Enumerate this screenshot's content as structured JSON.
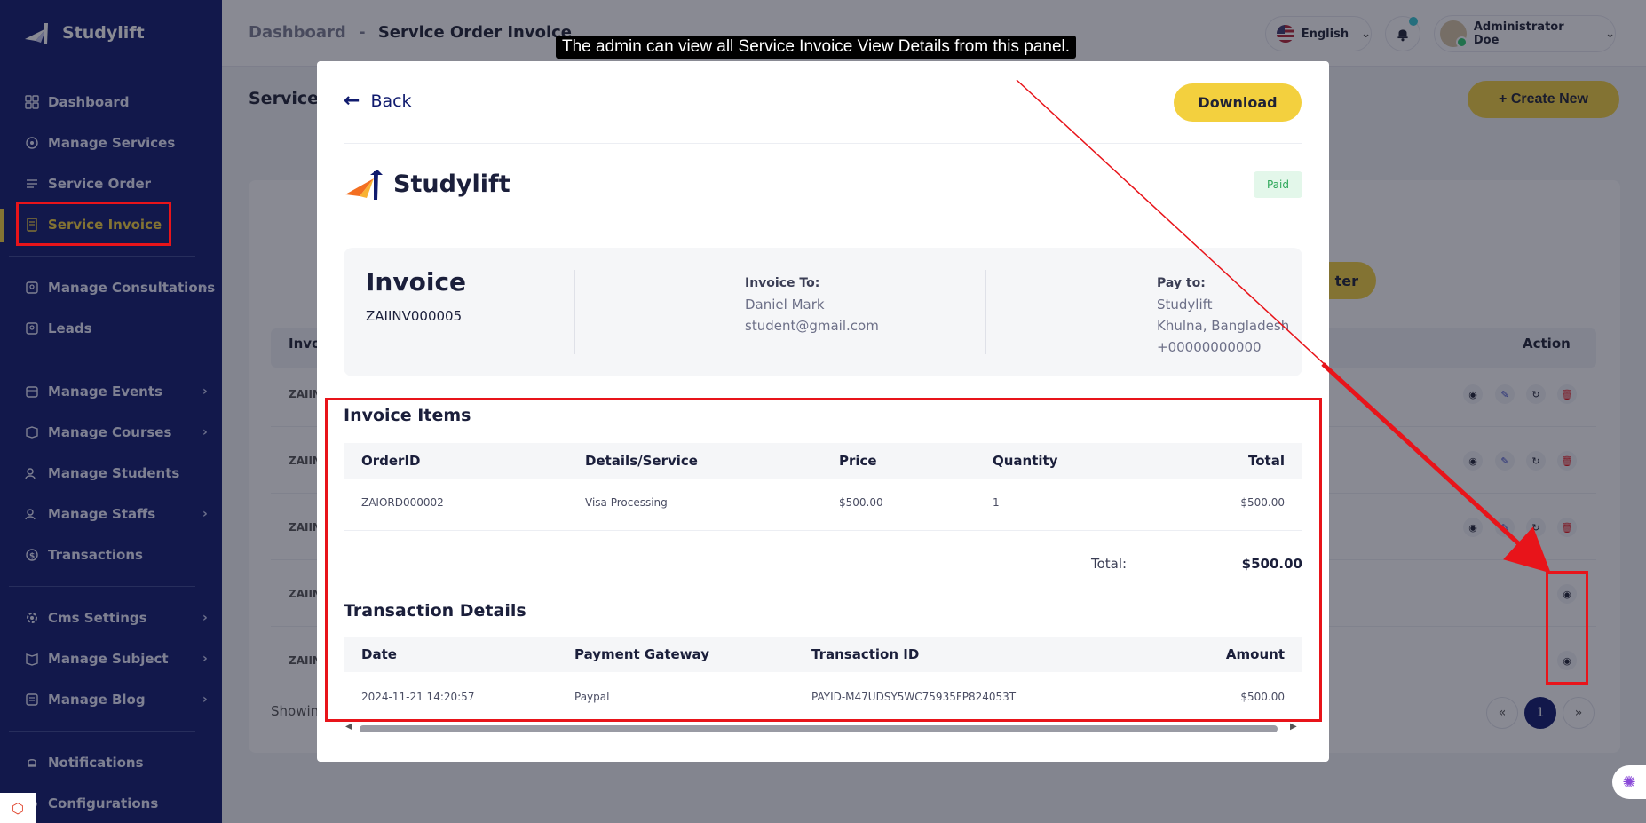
{
  "app": {
    "brand": "Studylift"
  },
  "sidebar": {
    "items": [
      {
        "label": "Dashboard"
      },
      {
        "label": "Manage Services"
      },
      {
        "label": "Service Order"
      },
      {
        "label": "Service Invoice"
      },
      {
        "label": "Manage Consultations"
      },
      {
        "label": "Leads"
      },
      {
        "label": "Manage Events"
      },
      {
        "label": "Manage Courses"
      },
      {
        "label": "Manage Students"
      },
      {
        "label": "Manage Staffs"
      },
      {
        "label": "Transactions"
      },
      {
        "label": "Cms Settings"
      },
      {
        "label": "Manage Subject"
      },
      {
        "label": "Manage Blog"
      },
      {
        "label": "Notifications"
      },
      {
        "label": "Configurations"
      }
    ]
  },
  "header": {
    "crumb_root": "Dashboard",
    "crumb_sep": "-",
    "crumb_current": "Service Order Invoice",
    "language": "English",
    "user_name": "Administrator Doe"
  },
  "background": {
    "page_title": "Service O",
    "create_new": "+ Create New",
    "filter": "ter",
    "col_invoice": "Invo",
    "col_action": "Action",
    "row_prefix": "ZAIIN",
    "showing": "Showin",
    "page_current": "1",
    "page_prev": "«",
    "page_next": "»"
  },
  "modal": {
    "back": "Back",
    "download": "Download",
    "brand": "Studylift",
    "status": "Paid",
    "invoice_title": "Invoice",
    "invoice_no": "ZAIINV000005",
    "invoice_to": {
      "label": "Invoice To:",
      "name": "Daniel Mark",
      "email": "student@gmail.com"
    },
    "pay_to": {
      "label": "Pay to:",
      "name": "Studylift",
      "address": "Khulna, Bangladesh",
      "phone": "+00000000000"
    },
    "items_title": "Invoice Items",
    "items_headers": [
      "OrderID",
      "Details/Service",
      "Price",
      "Quantity",
      "Total"
    ],
    "items_rows": [
      [
        "ZAIORD000002",
        "Visa Processing",
        "$500.00",
        "1",
        "$500.00"
      ]
    ],
    "total_label": "Total:",
    "total_value": "$500.00",
    "tx_title": "Transaction Details",
    "tx_headers": [
      "Date",
      "Payment Gateway",
      "Transaction ID",
      "Amount"
    ],
    "tx_rows": [
      [
        "2024-11-21 14:20:57",
        "Paypal",
        "PAYID-M47UDSY5WC75935FP824053T",
        "$500.00"
      ]
    ]
  },
  "annotation": {
    "tooltip": "The admin can view all Service Invoice View Details from this panel.",
    "highlight_color": "#e8141a"
  },
  "colors": {
    "sidebar": "#101b6e",
    "accent": "#f3d03e",
    "paid_bg": "#e3f7ea",
    "paid_text": "#2fa85b"
  }
}
